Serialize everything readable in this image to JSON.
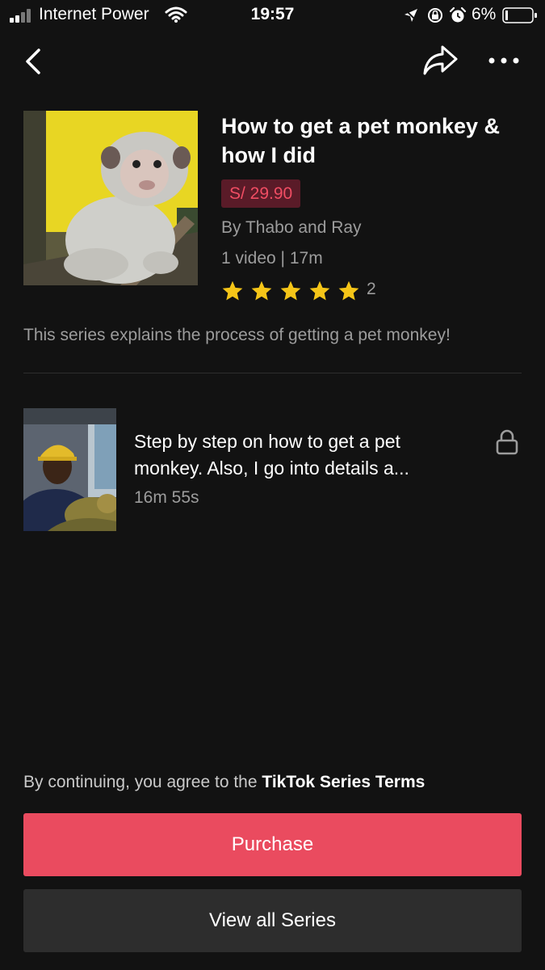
{
  "status_bar": {
    "carrier": "Internet Power",
    "time": "19:57",
    "battery": "6%"
  },
  "nav": {
    "back_icon": "chevron-left-icon",
    "share_icon": "share-icon",
    "more_icon": "more-dots-icon"
  },
  "series": {
    "title": "How to get a pet monkey & how I did",
    "price": "S/ 29.90",
    "author": "By Thabo and Ray",
    "meta": "1 video | 17m",
    "rating_stars": 5,
    "rating_count": "2",
    "description": "This series explains the process of getting a pet monkey!"
  },
  "episodes": [
    {
      "title": "Step by step on how to get a pet monkey. Also, I go into details a...",
      "duration": "16m 55s",
      "locked": true
    }
  ],
  "footer": {
    "terms_prefix": "By continuing, you agree to the ",
    "terms_link": "TikTok Series Terms",
    "purchase_label": "Purchase",
    "view_all_label": "View all Series"
  },
  "colors": {
    "background": "#121212",
    "accent": "#ea4b5f",
    "price_text": "#f04d63",
    "price_bg": "#5a1b28",
    "star": "#f5c518",
    "secondary_text": "#9c9c9c"
  }
}
